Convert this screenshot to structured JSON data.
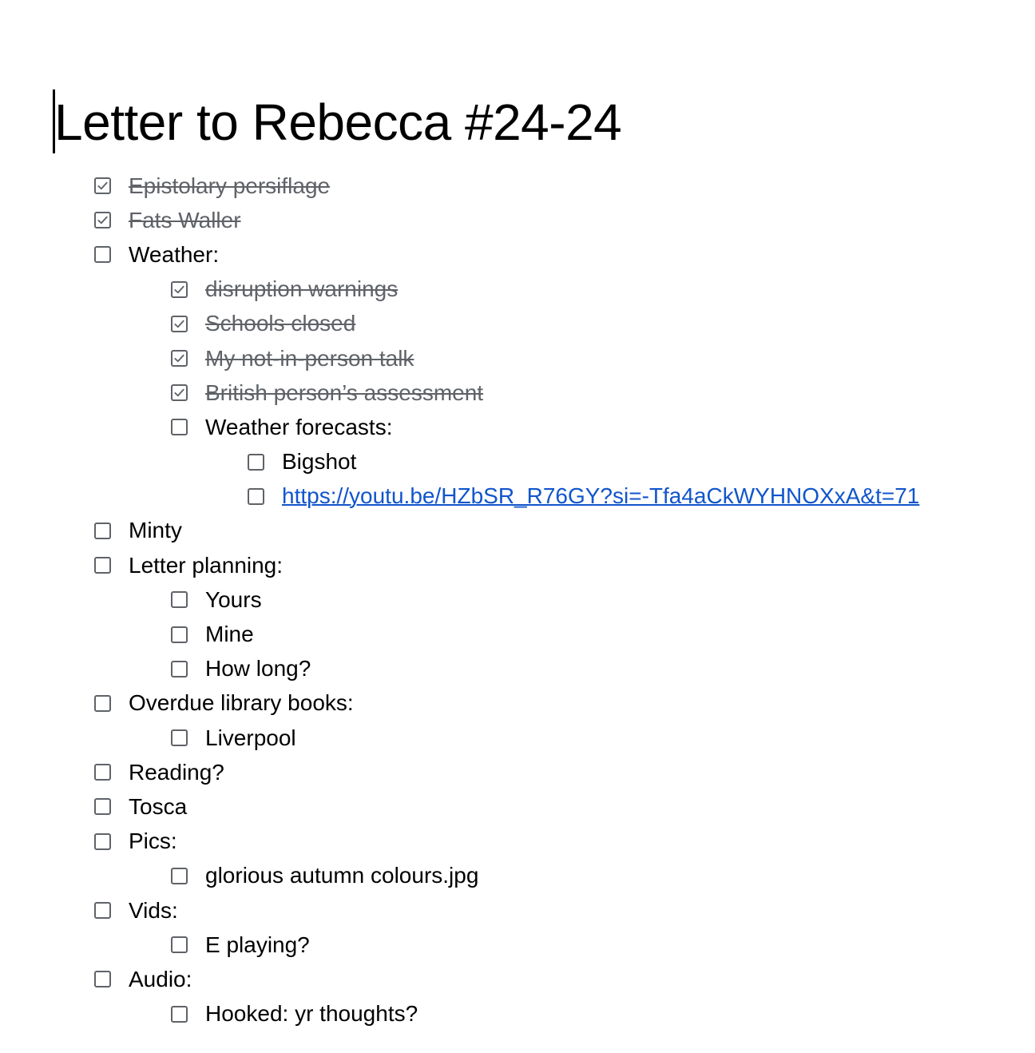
{
  "document": {
    "title": "Letter to Rebecca #24-24",
    "colors": {
      "text": "#000000",
      "checked_text": "#5f6368",
      "checkbox_border": "#5f6368",
      "link": "#1155cc"
    }
  },
  "checklist": [
    {
      "label": "Epistolary persiflage",
      "checked": true,
      "level": 0
    },
    {
      "label": "Fats Waller",
      "checked": true,
      "level": 0
    },
    {
      "label": "Weather:",
      "checked": false,
      "level": 0
    },
    {
      "label": "disruption warnings",
      "checked": true,
      "level": 1
    },
    {
      "label": "Schools closed",
      "checked": true,
      "level": 1
    },
    {
      "label": "My not-in-person talk",
      "checked": true,
      "level": 1
    },
    {
      "label": "British person’s assessment",
      "checked": true,
      "level": 1
    },
    {
      "label": "Weather forecasts:",
      "checked": false,
      "level": 1
    },
    {
      "label": "Bigshot",
      "checked": false,
      "level": 2
    },
    {
      "label": "https://youtu.be/HZbSR_R76GY?si=-Tfa4aCkWYHNOXxA&t=71",
      "checked": false,
      "level": 2,
      "is_link": true
    },
    {
      "label": "Minty",
      "checked": false,
      "level": 0
    },
    {
      "label": "Letter planning:",
      "checked": false,
      "level": 0
    },
    {
      "label": "Yours",
      "checked": false,
      "level": 1
    },
    {
      "label": "Mine",
      "checked": false,
      "level": 1
    },
    {
      "label": "How long?",
      "checked": false,
      "level": 1
    },
    {
      "label": "Overdue library books:",
      "checked": false,
      "level": 0
    },
    {
      "label": "Liverpool",
      "checked": false,
      "level": 1
    },
    {
      "label": "Reading?",
      "checked": false,
      "level": 0
    },
    {
      "label": "Tosca",
      "checked": false,
      "level": 0
    },
    {
      "label": "Pics:",
      "checked": false,
      "level": 0
    },
    {
      "label": "glorious autumn colours.jpg",
      "checked": false,
      "level": 1
    },
    {
      "label": "Vids:",
      "checked": false,
      "level": 0
    },
    {
      "label": "E playing?",
      "checked": false,
      "level": 1
    },
    {
      "label": "Audio:",
      "checked": false,
      "level": 0
    },
    {
      "label": "Hooked: yr thoughts?",
      "checked": false,
      "level": 1
    }
  ]
}
